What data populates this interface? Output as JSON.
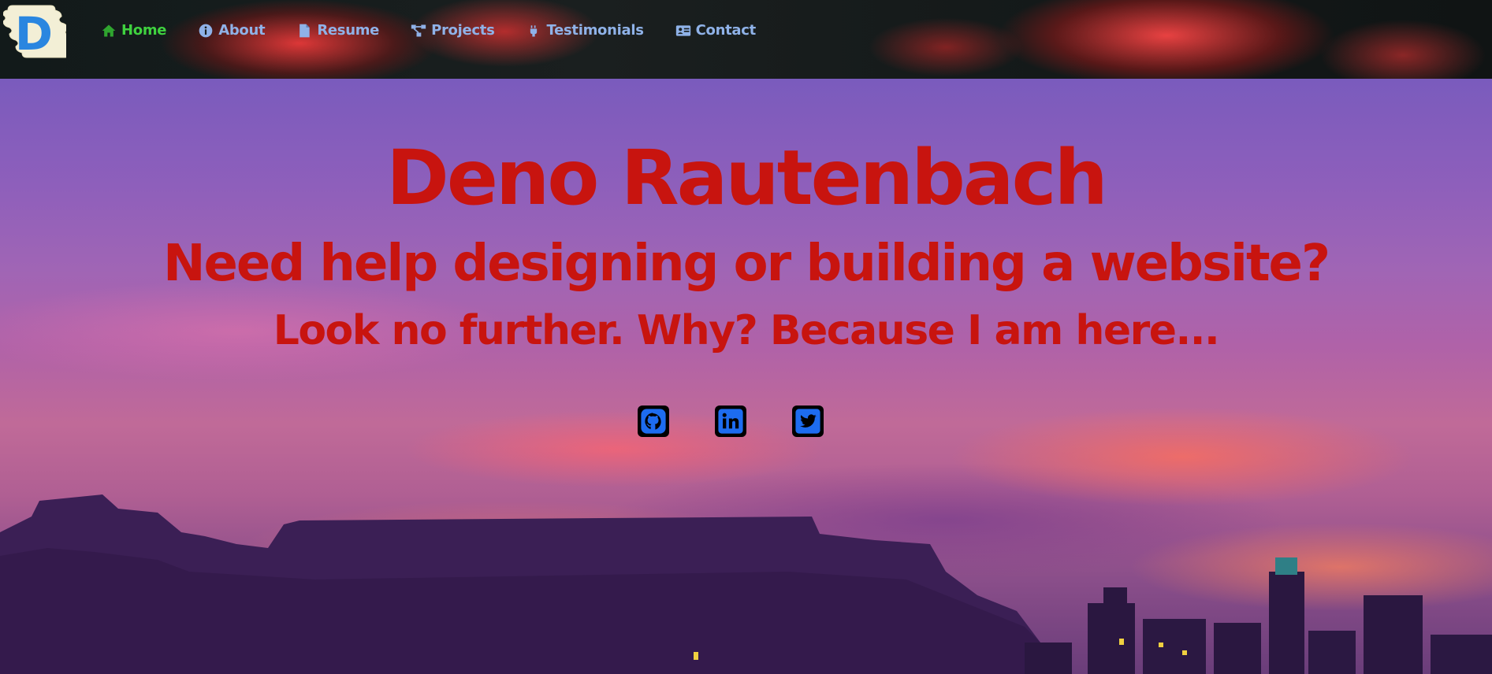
{
  "logo": {
    "letter": "D",
    "icon": "logo-d-icon"
  },
  "nav": {
    "items": [
      {
        "label": "Home",
        "icon": "home-icon",
        "active": true
      },
      {
        "label": "About",
        "icon": "info-icon",
        "active": false
      },
      {
        "label": "Resume",
        "icon": "file-icon",
        "active": false
      },
      {
        "label": "Projects",
        "icon": "project-diagram-icon",
        "active": false
      },
      {
        "label": "Testimonials",
        "icon": "testimonial-icon",
        "active": false
      },
      {
        "label": "Contact",
        "icon": "contact-card-icon",
        "active": false
      }
    ]
  },
  "hero": {
    "name": "Deno Rautenbach",
    "tagline": "Need help designing or building a website?",
    "subtagline": "Look no further. Why? Because I am here..."
  },
  "socials": [
    {
      "name": "GitHub",
      "icon": "github-icon"
    },
    {
      "name": "LinkedIn",
      "icon": "linkedin-icon"
    },
    {
      "name": "Twitter",
      "icon": "twitter-icon"
    }
  ],
  "colors": {
    "nav_text": "#8fb2e8",
    "nav_active": "#3fd23f",
    "hero_text": "#c8140f",
    "social_icon": "#1d6cf0"
  }
}
